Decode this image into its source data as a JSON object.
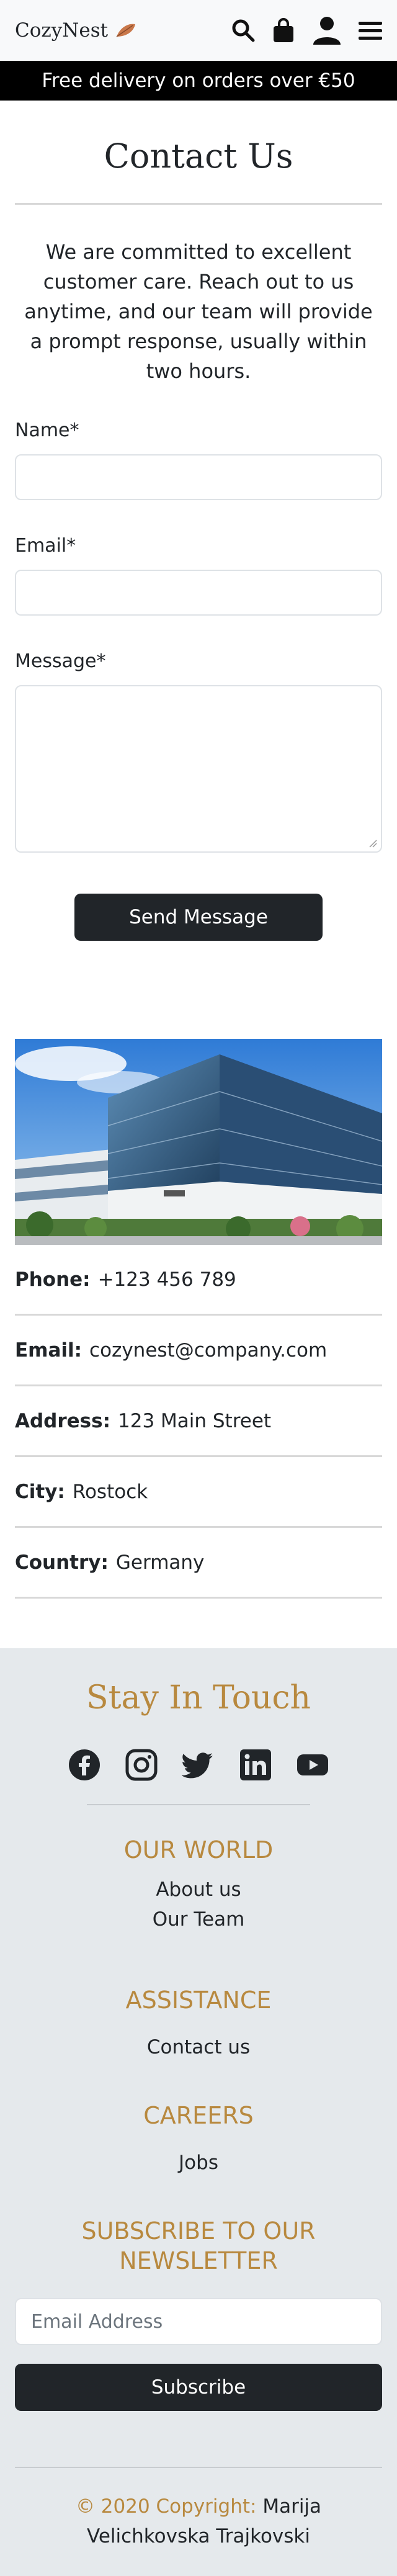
{
  "header": {
    "brand": "CozyNest",
    "icons": [
      "search-icon",
      "shopping-bag-icon",
      "user-icon",
      "menu-icon"
    ]
  },
  "promo": {
    "text": "Free delivery on orders over €50"
  },
  "contact": {
    "title": "Contact Us",
    "intro": "We are committed to excellent customer care. Reach out to us anytime, and our team will provide a prompt response, usually within two hours.",
    "name_label": "Name*",
    "email_label": "Email*",
    "message_label": "Message*",
    "name_value": "",
    "email_value": "",
    "message_value": "",
    "send_label": "Send Message"
  },
  "info": {
    "phone_label": "Phone:",
    "phone_value": "+123 456 789",
    "email_label": "Email:",
    "email_value": "cozynest@company.com",
    "address_label": "Address:",
    "address_value": "123 Main Street",
    "city_label": "City:",
    "city_value": "Rostock",
    "country_label": "Country:",
    "country_value": "Germany"
  },
  "footer": {
    "stay_title": "Stay In Touch",
    "socials": [
      "facebook-icon",
      "instagram-icon",
      "twitter-icon",
      "linkedin-icon",
      "youtube-icon"
    ],
    "world_title": "OUR WORLD",
    "world_links": [
      "About us",
      "Our Team"
    ],
    "assistance_title": "ASSISTANCE",
    "assistance_links": [
      "Contact us"
    ],
    "careers_title": "CAREERS",
    "careers_links": [
      "Jobs"
    ],
    "newsletter_title": "SUBSCRIBE TO OUR NEWSLETTER",
    "newsletter_placeholder": "Email Address",
    "subscribe_label": "Subscribe",
    "copyright_prefix": "© 2020 Copyright:",
    "copyright_name": "Marija Velichkovska Trajkovski"
  },
  "colors": {
    "accent_gold": "#b8893f",
    "dark": "#212529",
    "footer_bg": "#e5e9ec"
  }
}
